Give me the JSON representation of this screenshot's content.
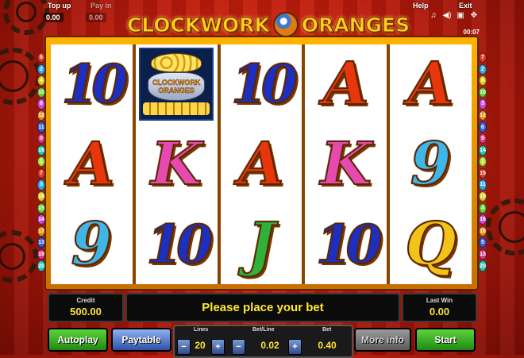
{
  "top": {
    "top_up_label": "Top up",
    "pay_in_label": "Pay in",
    "top_up_value": "0.00",
    "pay_in_value": "0.00",
    "help_label": "Help",
    "exit_label": "Exit",
    "timer": "00:07"
  },
  "logo": {
    "left_word": "CLOCKWORK",
    "right_word": "ORANGES"
  },
  "icons": [
    "music-icon",
    "speaker-icon",
    "fullscreen-icon",
    "settings-icon"
  ],
  "reels": [
    [
      {
        "type": "ten",
        "text": "10",
        "color": "#1d2fbf"
      },
      {
        "type": "single",
        "text": "A",
        "color": "#e8360c"
      },
      {
        "type": "single",
        "text": "9",
        "color": "#3fb6e8"
      }
    ],
    [
      {
        "type": "bonus",
        "text": "CLOCKWORK ORANGES",
        "color": "#ff9a00"
      },
      {
        "type": "single",
        "text": "K",
        "color": "#e74aae"
      },
      {
        "type": "ten",
        "text": "10",
        "color": "#1d2fbf"
      }
    ],
    [
      {
        "type": "ten",
        "text": "10",
        "color": "#1d2fbf"
      },
      {
        "type": "single",
        "text": "A",
        "color": "#e8360c"
      },
      {
        "type": "single",
        "text": "J",
        "color": "#2fb13a"
      }
    ],
    [
      {
        "type": "single",
        "text": "A",
        "color": "#e8360c"
      },
      {
        "type": "single",
        "text": "K",
        "color": "#e74aae"
      },
      {
        "type": "ten",
        "text": "10",
        "color": "#1d2fbf"
      }
    ],
    [
      {
        "type": "single",
        "text": "A",
        "color": "#e8360c"
      },
      {
        "type": "single",
        "text": "9",
        "color": "#3fb6e8"
      },
      {
        "type": "single",
        "text": "Q",
        "color": "#f2c318"
      }
    ]
  ],
  "paylines": {
    "left": [
      "6",
      "2",
      "4",
      "10",
      "8",
      "12",
      "11",
      "9",
      "16",
      "1",
      "7",
      "3",
      "18",
      "15",
      "14",
      "17",
      "13",
      "19",
      "20"
    ],
    "right": [
      "7",
      "2",
      "8",
      "10",
      "3",
      "12",
      "6",
      "9",
      "14",
      "1",
      "15",
      "11",
      "19",
      "4",
      "16",
      "18",
      "5",
      "13",
      "20"
    ],
    "colors": [
      "#e23a2a",
      "#36a8e8",
      "#e8c61c",
      "#6ad03a",
      "#d04ad8",
      "#f08a1a",
      "#3a5ee0",
      "#e23a8a",
      "#2ac8b8",
      "#b8e03a"
    ]
  },
  "panel": {
    "credit_label": "Credit",
    "credit_value": "500.00",
    "message": "Please place your bet",
    "last_win_label": "Last Win",
    "last_win_value": "0.00",
    "autoplay_label": "Autoplay",
    "paytable_label": "Paytable",
    "lines_label": "Lines",
    "lines_value": "20",
    "betline_label": "Bet/Line",
    "betline_value": "0.02",
    "bet_label": "Bet",
    "bet_value": "0.40",
    "more_info_label": "More info",
    "start_label": "Start",
    "minus": "−",
    "plus": "+"
  }
}
